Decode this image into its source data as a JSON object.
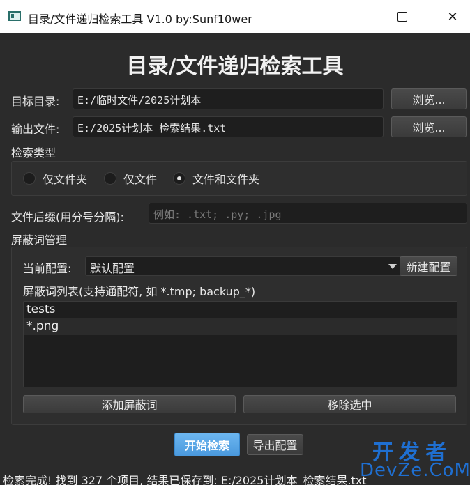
{
  "window": {
    "title": "目录/文件递归检索工具 V1.0 by:Sunf10wer",
    "minimize": "–",
    "maximize": "□",
    "close": "✕"
  },
  "header": {
    "title": "目录/文件递归检索工具"
  },
  "target": {
    "label": "目标目录:",
    "value": "E:/临时文件/2025计划本",
    "browse": "浏览..."
  },
  "output": {
    "label": "输出文件:",
    "value": "E:/2025计划本_检索结果.txt",
    "browse": "浏览..."
  },
  "search_type": {
    "label": "检索类型",
    "options": [
      "仅文件夹",
      "仅文件",
      "文件和文件夹"
    ],
    "selected": "文件和文件夹"
  },
  "suffix": {
    "label": "文件后缀(用分号分隔):",
    "placeholder": "例如: .txt; .py; .jpg"
  },
  "blocklist": {
    "label": "屏蔽词管理",
    "config_label": "当前配置:",
    "config_value": "默认配置",
    "new_config": "新建配置",
    "list_label": "屏蔽词列表(支持通配符, 如 *.tmp; backup_*)",
    "items": [
      "tests",
      "*.png"
    ],
    "add": "添加屏蔽词",
    "remove": "移除选中"
  },
  "actions": {
    "start": "开始检索",
    "export": "导出配置"
  },
  "status": "检索完成! 找到 327 个项目, 结果已保存到: E:/2025计划本_检索结果.txt",
  "watermark": {
    "top": "开发者",
    "bottom": "DevZe.CoM"
  }
}
